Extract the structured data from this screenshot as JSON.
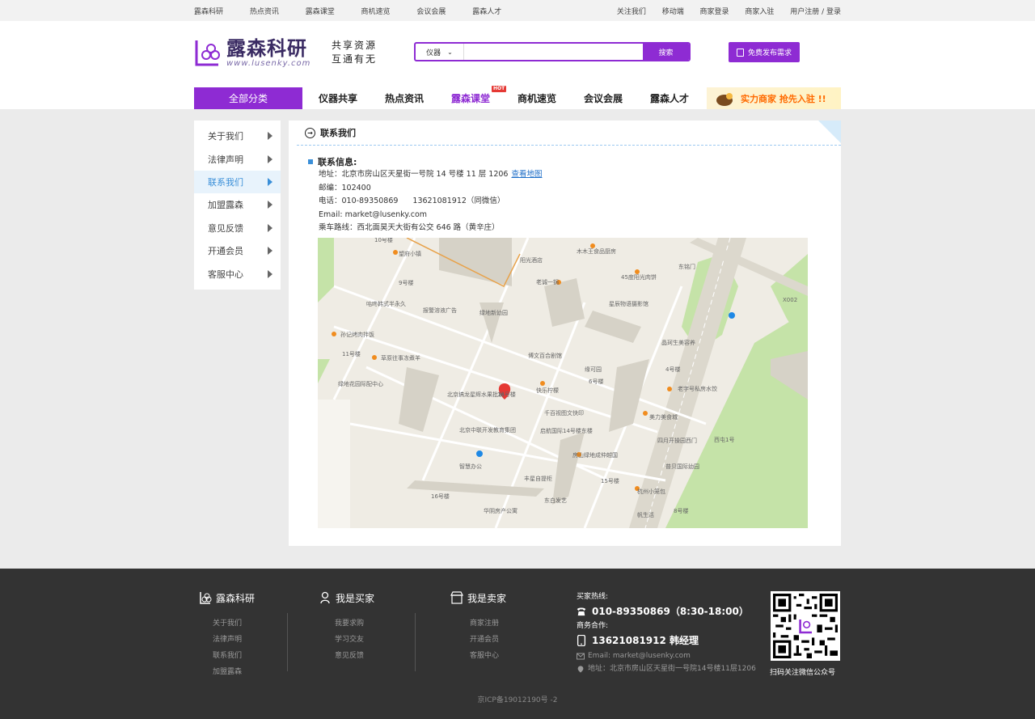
{
  "topbar": {
    "left": [
      "露森科研",
      "热点资讯",
      "露森课堂",
      "商机速览",
      "会议会展",
      "露森人才"
    ],
    "right": [
      "关注我们",
      "移动端",
      "商家登录",
      "商家入驻",
      "用户注册 / 登录"
    ]
  },
  "header": {
    "logo_cn": "露森科研",
    "logo_en": "www.lusenky.com",
    "slogan_1": "共享资源",
    "slogan_2": "互通有无",
    "search_category": "仪器",
    "search_button": "搜索",
    "publish_button": "免费发布需求"
  },
  "nav": {
    "all": "全部分类",
    "items": [
      "仪器共享",
      "热点资讯",
      "露森课堂",
      "商机速览",
      "会议会展",
      "露森人才"
    ],
    "hot_badge": "HOT",
    "promo": "实力商家  抢先入驻 !!"
  },
  "sidebar": {
    "items": [
      "关于我们",
      "法律声明",
      "联系我们",
      "加盟露森",
      "意见反馈",
      "开通会员",
      "客服中心"
    ]
  },
  "content": {
    "title": "联系我们",
    "info_head": "联系信息:",
    "address": "地址：北京市房山区天星街一号院 14 号楼 11 层 1206",
    "map_link": "查看地图",
    "postcode": "邮编：102400",
    "phone": "电话：010-89350869",
    "mobile": "13621081912（同微信）",
    "email": "Email: market@lusenky.com",
    "route": "乘车路线：西北面昊天大街有公交 646 路（黄辛庄）"
  },
  "map": {
    "labels": [
      "10号楼",
      "望府小镇",
      "木木王食品厨房",
      "45度阳光肉饼",
      "老诚一锅",
      "9号楼",
      "阳光酒店",
      "东铭门",
      "咕咚韩式半永久美睫工作室",
      "报警溶液广告",
      "绿地新幼园",
      "星辰物语摄影馆",
      "孙记烤肉拌饭",
      "晶珂生美容养生SPA工作室",
      "11号楼",
      "草原往事冻煮羊",
      "博文百合剧馆",
      "缘可园",
      "6号楼",
      "4号楼",
      "绿地花园际配中心",
      "北京搞龙星辉水果批发",
      "快乐柠檬",
      "老字号私房水饺",
      "14号楼",
      "千百视图文快印",
      "美力美食城",
      "北京中联开发教育集团",
      "启航国际14号楼东楼",
      "四月开操园西门",
      "房山绿地成仲越国老北门烧饼",
      "西屯1号",
      "智慧办公",
      "普贝国际幼园",
      "丰星自提柜",
      "15号楼",
      "杭州小笼包",
      "16号楼",
      "华阴房产公寓",
      "东白发艺",
      "帆生活",
      "8号楼",
      "X002"
    ]
  },
  "footer": {
    "brand": "露森科研",
    "buyer": "我是买家",
    "seller": "我是卖家",
    "brand_links": [
      "关于我们",
      "法律声明",
      "联系我们",
      "加盟露森"
    ],
    "buyer_links": [
      "我要求购",
      "学习交友",
      "意见反馈"
    ],
    "seller_links": [
      "商家注册",
      "开通会员",
      "客服中心"
    ],
    "hotline_label": "买家热线:",
    "hotline": "010-89350869（8:30-18:00）",
    "biz_label": "商务合作:",
    "biz_phone": "13621081912  韩经理",
    "email": "Email: market@lusenky.com",
    "address": "地址：北京市房山区天星街一号院14号楼11层1206",
    "qr_caption": "扫码关注微信公众号",
    "icp": "京ICP备19012190号 -2"
  },
  "colors": {
    "brand": "#8e2bd3",
    "link": "#1f6fc8",
    "footer_bg": "#333333",
    "main_bg": "#ebebeb"
  }
}
